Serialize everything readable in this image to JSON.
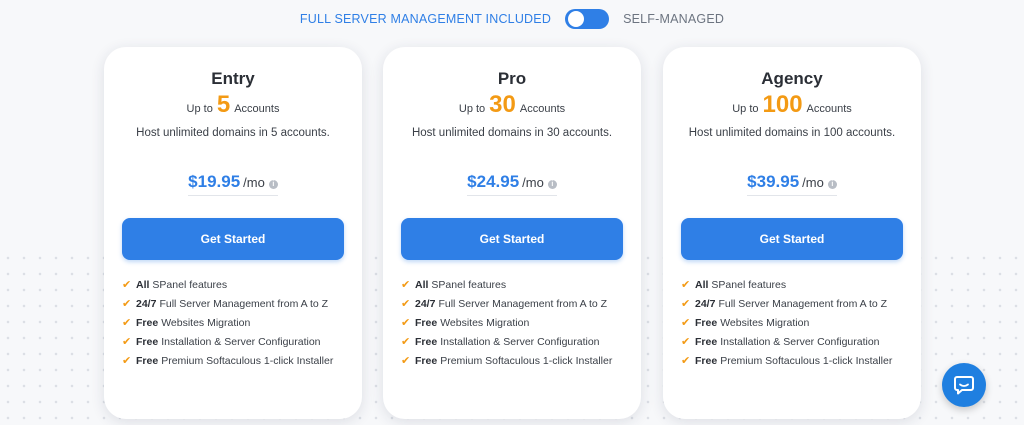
{
  "toggle": {
    "left_label": "FULL SERVER MANAGEMENT INCLUDED",
    "right_label": "SELF-MANAGED",
    "state": "off"
  },
  "plans": [
    {
      "name": "Entry",
      "up_to": "Up to",
      "accounts": "5",
      "accounts_label": "Accounts",
      "description": "Host unlimited domains in 5 accounts.",
      "price": "$19.95",
      "period": "/mo",
      "cta": "Get Started",
      "features": [
        {
          "bold": "All",
          "text": "SPanel features"
        },
        {
          "bold": "24/7",
          "text": "Full Server Management from A to Z"
        },
        {
          "bold": "Free",
          "text": "Websites Migration"
        },
        {
          "bold": "Free",
          "text": "Installation & Server Configuration"
        },
        {
          "bold": "Free",
          "text": "Premium Softaculous 1-click Installer"
        }
      ]
    },
    {
      "name": "Pro",
      "up_to": "Up to",
      "accounts": "30",
      "accounts_label": "Accounts",
      "description": "Host unlimited domains in 30 accounts.",
      "price": "$24.95",
      "period": "/mo",
      "cta": "Get Started",
      "features": [
        {
          "bold": "All",
          "text": "SPanel features"
        },
        {
          "bold": "24/7",
          "text": "Full Server Management from A to Z"
        },
        {
          "bold": "Free",
          "text": "Websites Migration"
        },
        {
          "bold": "Free",
          "text": "Installation & Server Configuration"
        },
        {
          "bold": "Free",
          "text": "Premium Softaculous 1-click Installer"
        }
      ]
    },
    {
      "name": "Agency",
      "up_to": "Up to",
      "accounts": "100",
      "accounts_label": "Accounts",
      "description": "Host unlimited domains in 100 accounts.",
      "price": "$39.95",
      "period": "/mo",
      "cta": "Get Started",
      "features": [
        {
          "bold": "All",
          "text": "SPanel features"
        },
        {
          "bold": "24/7",
          "text": "Full Server Management from A to Z"
        },
        {
          "bold": "Free",
          "text": "Websites Migration"
        },
        {
          "bold": "Free",
          "text": "Installation & Server Configuration"
        },
        {
          "bold": "Free",
          "text": "Premium Softaculous 1-click Installer"
        }
      ]
    }
  ],
  "icons": {
    "check": "check-icon",
    "info": "info-icon",
    "chat": "chat-icon"
  },
  "colors": {
    "accent_blue": "#2f7fe6",
    "accent_orange": "#f39a14",
    "chat_blue": "#1f7fe0"
  }
}
